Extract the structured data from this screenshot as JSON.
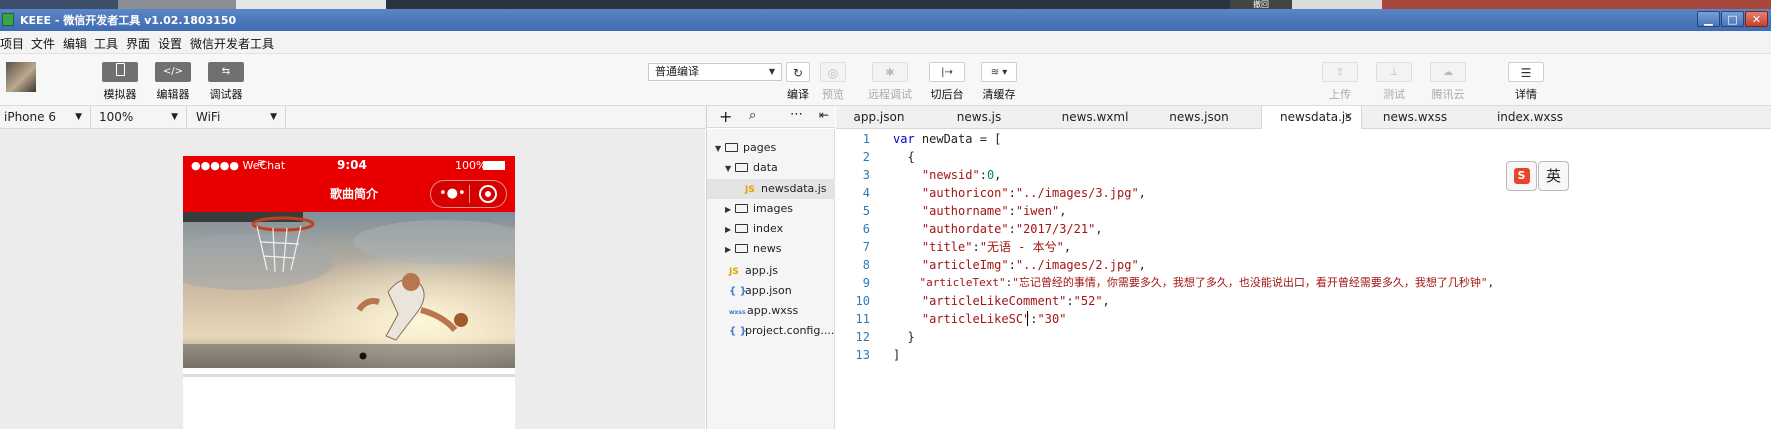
{
  "window": {
    "title": "KEEE - 微信开发者工具 v1.02.1803150",
    "buttons": {
      "minimize": "▁",
      "maximize": "□",
      "close": "✕"
    },
    "top_strip_label": "撤回"
  },
  "menu": [
    "项目",
    "文件",
    "编辑",
    "工具",
    "界面",
    "设置",
    "微信开发者工具"
  ],
  "toolbar": {
    "left_buttons": [
      {
        "label": "模拟器",
        "icon": "phone-icon"
      },
      {
        "label": "编辑器",
        "icon": "code-icon"
      },
      {
        "label": "调试器",
        "icon": "debug-icon"
      }
    ],
    "compile_mode": "普通编译",
    "center_buttons": [
      {
        "label": "编译",
        "icon": "refresh-icon",
        "enabled": true
      },
      {
        "label": "预览",
        "icon": "eye-icon",
        "enabled": false
      },
      {
        "label": "远程调试",
        "icon": "bug-icon",
        "enabled": false
      },
      {
        "label": "切后台",
        "icon": "switch-icon",
        "enabled": true
      },
      {
        "label": "清缓存",
        "icon": "layers-icon",
        "enabled": true
      }
    ],
    "right_buttons": [
      {
        "label": "上传",
        "icon": "upload-icon",
        "enabled": false
      },
      {
        "label": "测试",
        "icon": "flask-icon",
        "enabled": false
      },
      {
        "label": "腾讯云",
        "icon": "cloud-icon",
        "enabled": false
      },
      {
        "label": "详情",
        "icon": "menu-icon",
        "enabled": true
      }
    ]
  },
  "device_bar": {
    "device": "iPhone 6",
    "zoom": "100%",
    "network": "WiFi"
  },
  "simulator": {
    "carrier": "●●●●● WeChat",
    "time": "9:04",
    "battery": "100%",
    "nav_title": "歌曲简介"
  },
  "file_tree": {
    "items": [
      {
        "label": "pages",
        "type": "folder",
        "expanded": true,
        "depth": 0
      },
      {
        "label": "data",
        "type": "folder",
        "expanded": true,
        "depth": 1
      },
      {
        "label": "newsdata.js",
        "type": "js",
        "depth": 2,
        "selected": true
      },
      {
        "label": "images",
        "type": "folder",
        "expanded": false,
        "depth": 1
      },
      {
        "label": "index",
        "type": "folder",
        "expanded": false,
        "depth": 1
      },
      {
        "label": "news",
        "type": "folder",
        "expanded": false,
        "depth": 1
      },
      {
        "label": "app.js",
        "type": "js",
        "depth": 0
      },
      {
        "label": "app.json",
        "type": "json",
        "depth": 0
      },
      {
        "label": "app.wxss",
        "type": "wxss",
        "depth": 0
      },
      {
        "label": "project.config....",
        "type": "json",
        "depth": 0
      }
    ],
    "icon_labels": {
      "js": "JS",
      "json": "{ }",
      "wxss": "wxss"
    }
  },
  "tabs": [
    {
      "label": "app.json",
      "active": false
    },
    {
      "label": "news.js",
      "active": false
    },
    {
      "label": "news.wxml",
      "active": false
    },
    {
      "label": "news.json",
      "active": false
    },
    {
      "label": "newsdata.js",
      "active": true
    },
    {
      "label": "news.wxss",
      "active": false
    },
    {
      "label": "index.wxss",
      "active": false
    }
  ],
  "editor": {
    "line_numbers": [
      "1",
      "2",
      "3",
      "4",
      "5",
      "6",
      "7",
      "8",
      "9",
      "10",
      "11",
      "12",
      "13"
    ],
    "lines": [
      "var newData = [",
      "  {",
      "    \"newsid\":0,",
      "    \"authoricon\":\"../images/3.jpg\",",
      "    \"authorname\":\"iwen\",",
      "    \"authordate\":\"2017/3/21\",",
      "    \"title\":\"无语 - 本兮\",",
      "    \"articleImg\":\"../images/2.jpg\",",
      "    \"articleText\":\"忘记曾经的事情，你需要多久，我想了多久，也没能说出口，看开曾经需要多久，我想了几秒钟\",",
      "    \"articleLikeComment\":\"52\",",
      "    \"articleLikeSC\":\"30\"",
      "  }",
      "]"
    ]
  },
  "ime": {
    "logo": "S",
    "mode": "英"
  },
  "colors": {
    "nav_red": "#e80000",
    "titlebar_blue": "#4a78bc",
    "keyword": "#0000cc",
    "string": "#a31515",
    "number": "#098658",
    "line_number": "#2a7bb8"
  }
}
